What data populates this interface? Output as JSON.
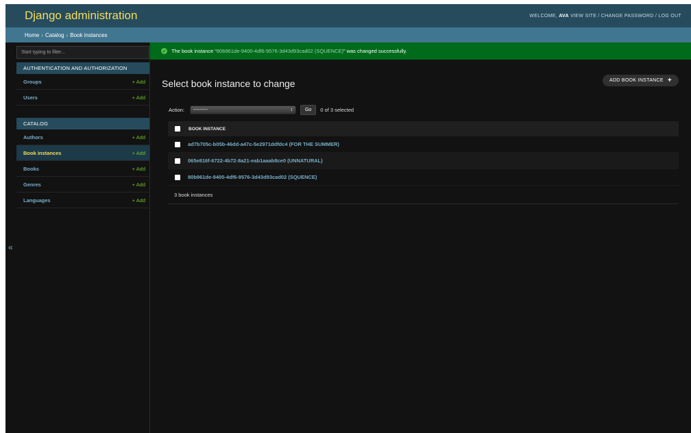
{
  "header": {
    "branding": "Django administration",
    "welcome": "WELCOME,",
    "username": "AVA",
    "view_site": "VIEW SITE",
    "change_password": "CHANGE PASSWORD",
    "log_out": "LOG OUT",
    "separator": "/"
  },
  "breadcrumbs": {
    "home": "Home",
    "app": "Catalog",
    "current": "Book instances",
    "sep": "›"
  },
  "sidebar": {
    "filter_placeholder": "Start typing to filter...",
    "toggle": "«",
    "modules": [
      {
        "caption": "AUTHENTICATION AND AUTHORIZATION",
        "rows": [
          {
            "label": "Groups",
            "add": "+ Add"
          },
          {
            "label": "Users",
            "add": "+ Add"
          }
        ]
      },
      {
        "caption": "CATALOG",
        "rows": [
          {
            "label": "Authors",
            "add": "+ Add"
          },
          {
            "label": "Book instances",
            "add": "+ Add"
          },
          {
            "label": "Books",
            "add": "+ Add"
          },
          {
            "label": "Genres",
            "add": "+ Add"
          },
          {
            "label": "Languages",
            "add": "+ Add"
          }
        ]
      }
    ]
  },
  "message": {
    "prefix": "The book instance “",
    "link": "80b961de-9400-4df6-9576-3d43d93cad02 (SQUENCE)",
    "suffix": "” was changed successfully."
  },
  "content": {
    "title": "Select book instance to change",
    "add_button": "ADD BOOK INSTANCE",
    "add_plus": "+",
    "action_label": "Action:",
    "action_value": "---------",
    "go_label": "Go",
    "counter": "0 of 3 selected",
    "column_header": "BOOK INSTANCE",
    "rows": [
      "ad7b705c-b05b-46dd-a47c-5e2971ddfdc4 (FOR THE SUMMER)",
      "065e816f-6722-4b72-8a21-eab1aaab8ce0 (UNNATURAL)",
      "80b961de-9400-4df6-9576-3d43d93cad02 (SQUENCE)"
    ],
    "paginator": "3 book instances"
  },
  "colors": {
    "header_bg": "#264b5d",
    "branding": "#f5dd5d",
    "breadcrumb_bg": "#417690",
    "success_bg": "#006b1b",
    "link": "#79aec8",
    "add_green": "#70bf2b"
  }
}
